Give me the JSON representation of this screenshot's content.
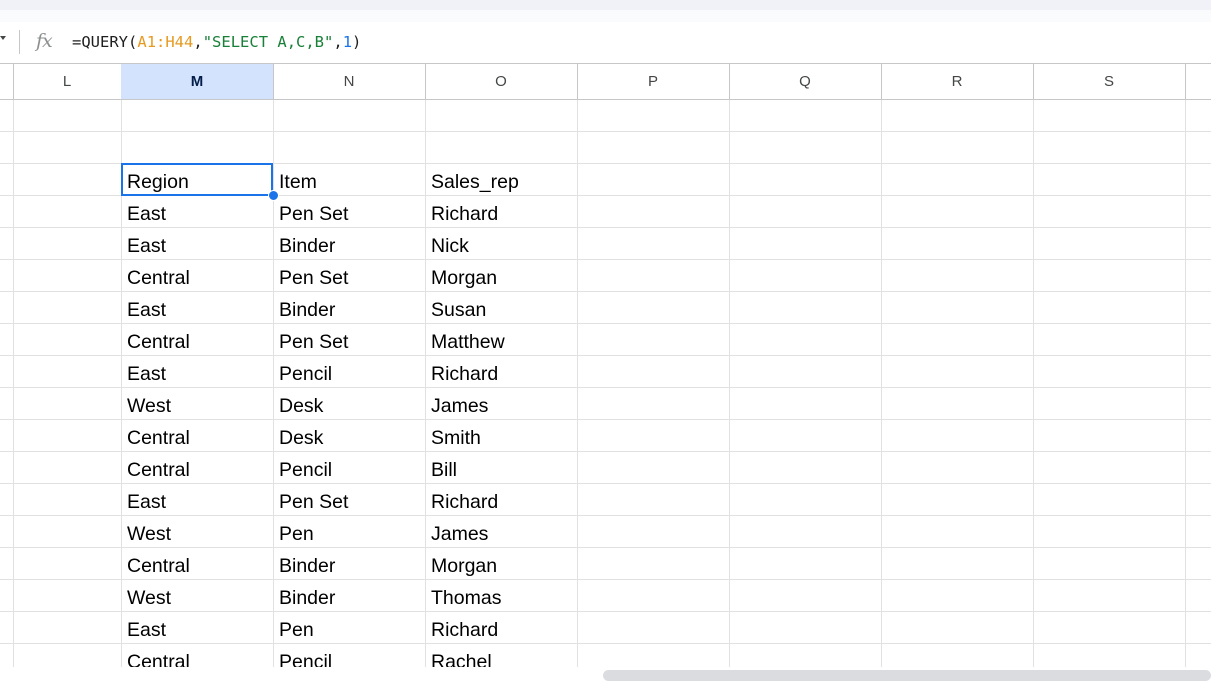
{
  "formula_bar": {
    "fx_label": "fx",
    "parts": {
      "eq": "=",
      "fn": "QUERY",
      "open": "(",
      "range": "A1:H44",
      "comma1": ",",
      "query": "\"SELECT A,C,B\"",
      "comma2": ",",
      "header": "1",
      "close": ")"
    }
  },
  "columns": [
    "L",
    "M",
    "N",
    "O",
    "P",
    "Q",
    "R",
    "S"
  ],
  "selected_column": "M",
  "table": {
    "headers": [
      "Region",
      "Item",
      "Sales_rep"
    ],
    "rows": [
      [
        "East",
        "Pen Set",
        "Richard"
      ],
      [
        "East",
        "Binder",
        "Nick"
      ],
      [
        "Central",
        "Pen Set",
        "Morgan"
      ],
      [
        "East",
        "Binder",
        "Susan"
      ],
      [
        "Central",
        "Pen Set",
        "Matthew"
      ],
      [
        "East",
        "Pencil",
        "Richard"
      ],
      [
        "West",
        "Desk",
        "James"
      ],
      [
        "Central",
        "Desk",
        "Smith"
      ],
      [
        "Central",
        "Pencil",
        "Bill"
      ],
      [
        "East",
        "Pen Set",
        "Richard"
      ],
      [
        "West",
        "Pen",
        "James"
      ],
      [
        "Central",
        "Binder",
        "Morgan"
      ],
      [
        "West",
        "Binder",
        "Thomas"
      ],
      [
        "East",
        "Pen",
        "Richard"
      ],
      [
        "Central",
        "Pencil",
        "Rachel"
      ]
    ]
  },
  "colors": {
    "selection": "#1a73e8",
    "header_selected_bg": "#d3e3fd",
    "range_ref": "#e69a22",
    "string_literal": "#188038",
    "number_literal": "#1a73e8"
  }
}
